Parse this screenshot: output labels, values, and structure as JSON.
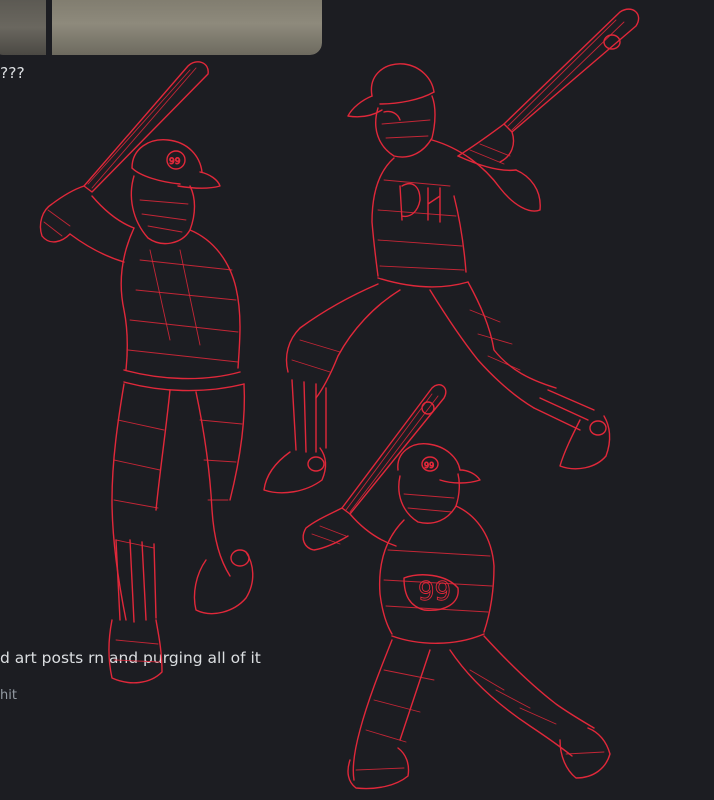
{
  "messages": [
    {
      "text": "???"
    },
    {
      "text": "d art posts rn and purging all of it"
    },
    {
      "text": "hit"
    }
  ],
  "sketch": {
    "jersey_number": "99"
  },
  "colors": {
    "background": "#1c1d22",
    "sketch_line": "#e0283a",
    "text": "#dbdee1",
    "muted_text": "#949ba4"
  }
}
